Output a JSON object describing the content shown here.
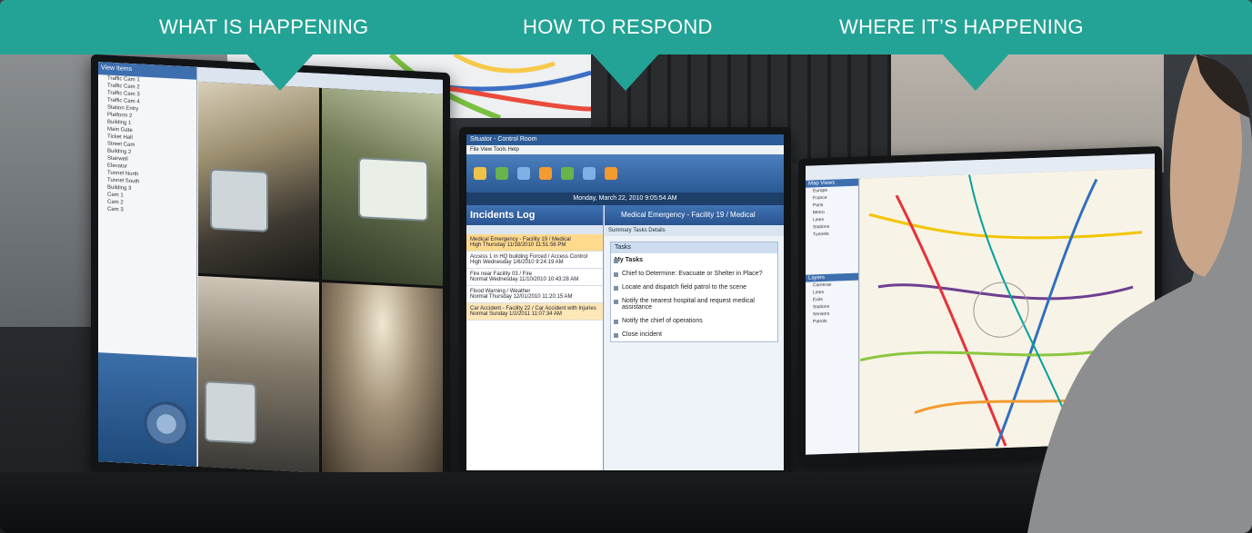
{
  "banner": {
    "labels": [
      "WHAT IS HAPPENING",
      "HOW TO RESPOND",
      "WHERE IT’S HAPPENING"
    ],
    "color": "#23a395"
  },
  "left_screen": {
    "tree_title": "View Items",
    "tree_items": [
      "Traffic Cam 1",
      "Traffic Cam 2",
      "Traffic Cam 3",
      "Traffic Cam 4",
      "Station Entry",
      "Platform 2",
      "Building 1",
      "Main Gate",
      "Ticket Hall",
      "Street Cam",
      "Building 2",
      "Stairwell",
      "Elevator",
      "Tunnel North",
      "Tunnel South",
      "Building 3",
      "Cam 1",
      "Cam 2",
      "Cam 3"
    ],
    "ptz_label": "Camera Control"
  },
  "middle_screen": {
    "window_title": "Situator - Control Room",
    "menu": "File   View   Tools   Help",
    "date": "Monday, March 22, 2010 9:05:54 AM",
    "log_title": "Incidents Log",
    "incidents": [
      {
        "title": "Medical Emergency - Facility 19 / Medical",
        "meta": "High    Thursday 11/18/2010 11:51:56 PM",
        "state": "sel"
      },
      {
        "title": "Access 1 in HQ building Forced / Access Control",
        "meta": "High    Wednesday 1/6/2010 9:24:19 AM",
        "state": "normal"
      },
      {
        "title": "Fire near Facility 03 / Fire",
        "meta": "Normal    Wednesday 11/10/2010 10:43:28 AM",
        "state": "normal"
      },
      {
        "title": "Flood Warning / Weather",
        "meta": "Normal    Thursday 12/01/2010 11:20:15 AM",
        "state": "normal"
      },
      {
        "title": "Car Accident - Facility 22 / Car Accident with Injuries",
        "meta": "Normal    Sunday 1/2/2011 11:07:34 AM",
        "state": "hi"
      }
    ],
    "detail_title": "Medical Emergency - Facility 19 / Medical",
    "detail_tabs": "Summary   Tasks   Details",
    "tasks_header": "Tasks",
    "my_tasks": "My Tasks",
    "tasks": [
      "Chief to Determine: Evacuate or Shelter in Place?",
      "Locate and dispatch field patrol to the scene",
      "Notify the nearest hospital and request medical assistance",
      "Notify the chief of operations",
      "Close incident"
    ]
  },
  "right_screen": {
    "side_title": "Map Views",
    "side_items": [
      "Europe",
      "France",
      "Paris",
      "Metro",
      "Lines",
      "Stations",
      "Tunnels"
    ],
    "layers_title": "Layers",
    "layer_items": [
      "Cameras",
      "Lines",
      "Exits",
      "Stations",
      "Sensors",
      "Patrols"
    ]
  }
}
